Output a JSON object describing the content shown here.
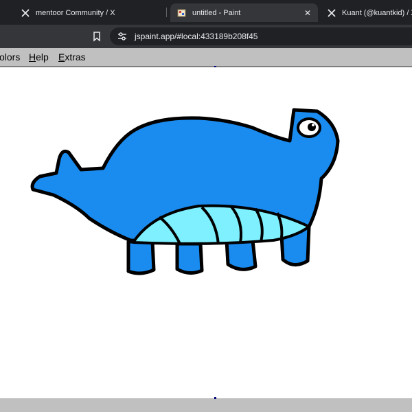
{
  "browser": {
    "tabs": [
      {
        "title": "mentoor Community / X",
        "favicon": "x-logo-icon",
        "active": false
      },
      {
        "title": "untitled - Paint",
        "favicon": "paint-icon",
        "active": true
      },
      {
        "title": "Kuant (@kuantkid) / X",
        "favicon": "x-logo-icon",
        "active": false
      }
    ],
    "url": "jspaint.app/#local:433189b208f45"
  },
  "paint": {
    "menus": [
      {
        "label": "olors",
        "accel": ""
      },
      {
        "label": "elp",
        "accel": "H"
      },
      {
        "label": "xtras",
        "accel": "E"
      }
    ],
    "drawing_colors": {
      "body": "#1a8cf0",
      "belly": "#7ff0ff",
      "outline": "#000000",
      "eye": "#ffffff"
    }
  }
}
